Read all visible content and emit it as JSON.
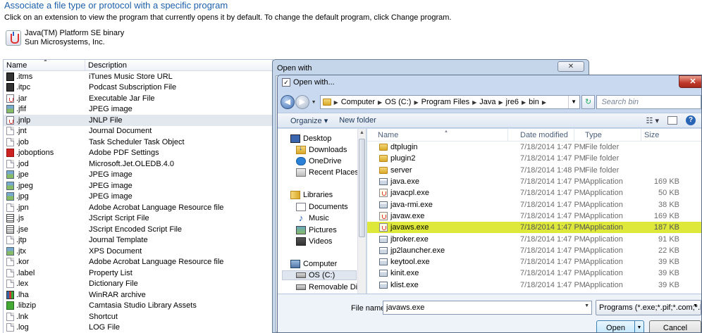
{
  "panel": {
    "title": "Associate a file type or protocol with a specific program",
    "instruction": "Click on an extension to view the program that currently opens it by default. To change the default program, click Change program.",
    "program_name": "Java(TM) Platform SE binary",
    "program_vendor": "Sun Microsystems, Inc.",
    "columns": {
      "name": "Name",
      "description": "Description"
    },
    "extensions": [
      {
        "name": ".itms",
        "description": "iTunes Music Store URL",
        "icon": "itm"
      },
      {
        "name": ".itpc",
        "description": "Podcast Subscription File",
        "icon": "itm"
      },
      {
        "name": ".jar",
        "description": "Executable Jar File",
        "icon": "java"
      },
      {
        "name": ".jfif",
        "description": "JPEG image",
        "icon": "img"
      },
      {
        "name": ".jnlp",
        "description": "JNLP File",
        "icon": "java"
      },
      {
        "name": ".jnt",
        "description": "Journal Document",
        "icon": "gen"
      },
      {
        "name": ".job",
        "description": "Task Scheduler Task Object",
        "icon": "gen"
      },
      {
        "name": ".joboptions",
        "description": "Adobe PDF Settings",
        "icon": "pdf"
      },
      {
        "name": ".jod",
        "description": "Microsoft.Jet.OLEDB.4.0",
        "icon": "gen"
      },
      {
        "name": ".jpe",
        "description": "JPEG image",
        "icon": "img"
      },
      {
        "name": ".jpeg",
        "description": "JPEG image",
        "icon": "img"
      },
      {
        "name": ".jpg",
        "description": "JPEG image",
        "icon": "img"
      },
      {
        "name": ".jpn",
        "description": "Adobe Acrobat Language Resource file",
        "icon": "gen"
      },
      {
        "name": ".js",
        "description": "JScript Script File",
        "icon": "script"
      },
      {
        "name": ".jse",
        "description": "JScript Encoded Script File",
        "icon": "script"
      },
      {
        "name": ".jtp",
        "description": "Journal Template",
        "icon": "gen"
      },
      {
        "name": ".jtx",
        "description": "XPS Document",
        "icon": "img"
      },
      {
        "name": ".kor",
        "description": "Adobe Acrobat Language Resource file",
        "icon": "gen"
      },
      {
        "name": ".label",
        "description": "Property List",
        "icon": "gen"
      },
      {
        "name": ".lex",
        "description": "Dictionary File",
        "icon": "gen"
      },
      {
        "name": ".lha",
        "description": "WinRAR archive",
        "icon": "rar"
      },
      {
        "name": ".libzip",
        "description": "Camtasia Studio Library Assets",
        "icon": "cam"
      },
      {
        "name": ".lnk",
        "description": "Shortcut",
        "icon": "gen"
      },
      {
        "name": ".log",
        "description": "LOG File",
        "icon": "gen"
      }
    ],
    "selected_index": 4
  },
  "openwith": {
    "title": "Open with",
    "close_glyph": "✕"
  },
  "dialog": {
    "title": "Open with...",
    "close_glyph": "✕",
    "breadcrumbs": [
      "Computer",
      "OS (C:)",
      "Program Files",
      "Java",
      "jre6",
      "bin"
    ],
    "search_placeholder": "Search bin",
    "toolbar": {
      "organize": "Organize ▾",
      "new_folder": "New folder"
    },
    "nav": {
      "desktop": "Desktop",
      "downloads": "Downloads",
      "onedrive": "OneDrive",
      "recent": "Recent Places",
      "libraries": "Libraries",
      "documents": "Documents",
      "music": "Music",
      "pictures": "Pictures",
      "videos": "Videos",
      "computer": "Computer",
      "os_c": "OS (C:)",
      "removable": "Removable Disk ("
    },
    "columns": {
      "name": "Name",
      "date": "Date modified",
      "type": "Type",
      "size": "Size"
    },
    "files": [
      {
        "name": "dtplugin",
        "date": "7/18/2014 1:47 PM",
        "type": "File folder",
        "size": "",
        "kind": "folder"
      },
      {
        "name": "plugin2",
        "date": "7/18/2014 1:47 PM",
        "type": "File folder",
        "size": "",
        "kind": "folder"
      },
      {
        "name": "server",
        "date": "7/18/2014 1:48 PM",
        "type": "File folder",
        "size": "",
        "kind": "folder"
      },
      {
        "name": "java.exe",
        "date": "7/18/2014 1:47 PM",
        "type": "Application",
        "size": "169 KB",
        "kind": "exe"
      },
      {
        "name": "javacpl.exe",
        "date": "7/18/2014 1:47 PM",
        "type": "Application",
        "size": "50 KB",
        "kind": "java"
      },
      {
        "name": "java-rmi.exe",
        "date": "7/18/2014 1:47 PM",
        "type": "Application",
        "size": "38 KB",
        "kind": "exe"
      },
      {
        "name": "javaw.exe",
        "date": "7/18/2014 1:47 PM",
        "type": "Application",
        "size": "169 KB",
        "kind": "java"
      },
      {
        "name": "javaws.exe",
        "date": "7/18/2014 1:47 PM",
        "type": "Application",
        "size": "187 KB",
        "kind": "java"
      },
      {
        "name": "jbroker.exe",
        "date": "7/18/2014 1:47 PM",
        "type": "Application",
        "size": "91 KB",
        "kind": "exe"
      },
      {
        "name": "jp2launcher.exe",
        "date": "7/18/2014 1:47 PM",
        "type": "Application",
        "size": "22 KB",
        "kind": "exe"
      },
      {
        "name": "keytool.exe",
        "date": "7/18/2014 1:47 PM",
        "type": "Application",
        "size": "39 KB",
        "kind": "exe"
      },
      {
        "name": "kinit.exe",
        "date": "7/18/2014 1:47 PM",
        "type": "Application",
        "size": "39 KB",
        "kind": "exe"
      },
      {
        "name": "klist.exe",
        "date": "7/18/2014 1:47 PM",
        "type": "Application",
        "size": "39 KB",
        "kind": "exe"
      }
    ],
    "selected_file": 7,
    "filename_label": "File name:",
    "filename_value": "javaws.exe",
    "filter_value": "Programs (*.exe;*.pif;*.com;*.ba",
    "open_label": "Open",
    "cancel_label": "Cancel",
    "highlight_color": "#dde83a"
  }
}
